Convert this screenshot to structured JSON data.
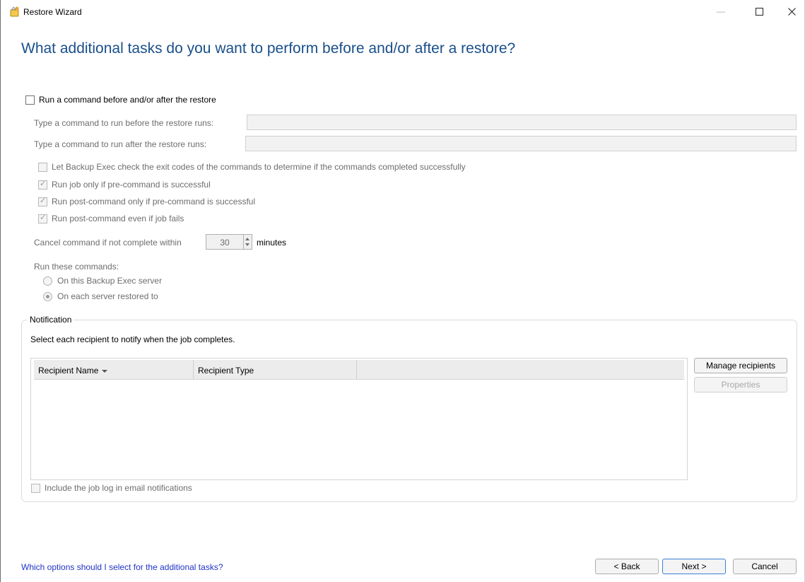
{
  "window": {
    "title": "Restore Wizard",
    "minimize_glyph": "—",
    "maximize_glyph": "☐",
    "close_glyph": "✕"
  },
  "heading": "What additional tasks do you want to perform before and/or after a restore?",
  "commands": {
    "run_command_label": "Run a command before and/or after the restore",
    "run_command_checked": false,
    "before_label": "Type a command to run before the restore runs:",
    "before_value": "",
    "after_label": "Type a command to run after the restore runs:",
    "after_value": "",
    "options": [
      {
        "label": "Let Backup Exec check the exit codes of the commands to determine if the commands completed successfully",
        "checked": false
      },
      {
        "label": "Run job only if pre-command is successful",
        "checked": true
      },
      {
        "label": "Run post-command only if pre-command is successful",
        "checked": true
      },
      {
        "label": "Run post-command even if job fails",
        "checked": true
      }
    ],
    "cancel_label": "Cancel command if not complete within",
    "cancel_value": "30",
    "cancel_unit": "minutes",
    "run_these_label": "Run these commands:",
    "run_on": [
      {
        "label": "On this Backup Exec server",
        "selected": false
      },
      {
        "label": "On each server restored to",
        "selected": true
      }
    ]
  },
  "notification": {
    "group_title": "Notification",
    "instruction": "Select each recipient to notify when the job completes.",
    "columns": [
      "Recipient Name",
      "Recipient Type"
    ],
    "rows": [],
    "manage_button": "Manage recipients",
    "properties_button": "Properties",
    "include_log_label": "Include the job log in email notifications",
    "include_log_checked": false
  },
  "footer": {
    "help_link": "Which options should I select for the additional tasks?",
    "back_button": "< Back",
    "next_button": "Next >",
    "cancel_button": "Cancel"
  },
  "icons": {
    "app": "restore-wizard-icon",
    "sort": "sort-descending-icon"
  },
  "colors": {
    "heading": "#1a4f8b",
    "link": "#2034c4",
    "disabled_text": "#6d6d6d"
  }
}
